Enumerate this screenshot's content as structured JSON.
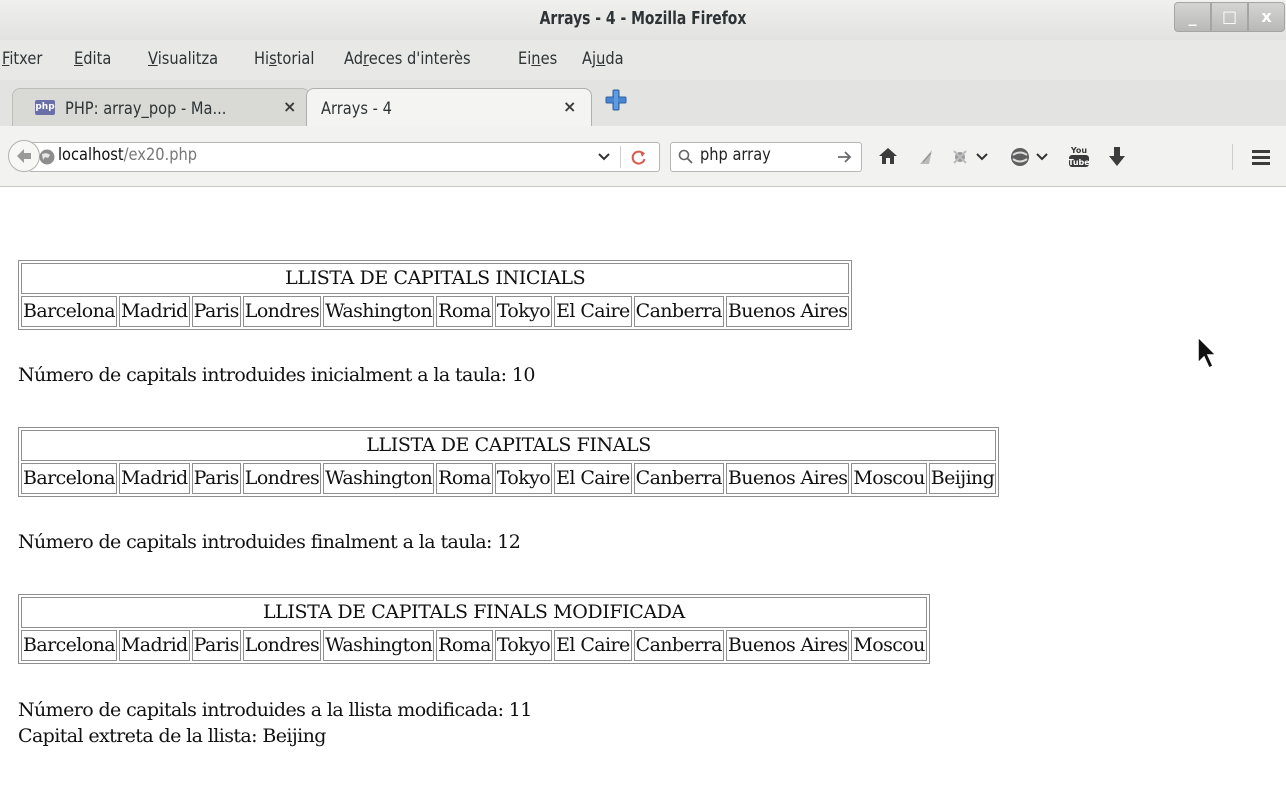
{
  "window": {
    "title": "Arrays - 4 - Mozilla Firefox",
    "minimize": "_",
    "maximize": "□",
    "close": "x"
  },
  "menu": [
    {
      "accel": "F",
      "rest": "itxer"
    },
    {
      "accel": "E",
      "rest": "dita"
    },
    {
      "accel": "V",
      "rest": "isualitza"
    },
    {
      "pre": "Hi",
      "accel": "s",
      "rest": "torial"
    },
    {
      "pre": "Ad",
      "accel": "r",
      "rest": "eces d'interès"
    },
    {
      "pre": "Ei",
      "accel": "n",
      "rest": "es"
    },
    {
      "pre": "Aj",
      "accel": "u",
      "rest": "da"
    }
  ],
  "tabs": [
    {
      "label": "PHP: array_pop - Ma...",
      "favicon": "php",
      "active": false
    },
    {
      "label": "Arrays - 4",
      "active": true
    }
  ],
  "tab_close_glyph": "×",
  "navbar": {
    "url_host": "localhost",
    "url_path": "/ex20.php",
    "search_value": "php array"
  },
  "icons": [
    "back-arrow-icon",
    "globe-icon",
    "dropdown-icon",
    "reload-icon",
    "search-icon",
    "search-go-icon",
    "home-icon",
    "bookmark-icon",
    "extension-icon",
    "pocket-icon",
    "youtube-icon",
    "download-icon",
    "menu-icon"
  ],
  "page": {
    "table1": {
      "heading": "LLISTA DE CAPITALS INICIALS",
      "cells": [
        "Barcelona",
        "Madrid",
        "Paris",
        "Londres",
        "Washington",
        "Roma",
        "Tokyo",
        "El Caire",
        "Canberra",
        "Buenos Aires"
      ]
    },
    "count1": "Número de capitals introduides inicialment a la taula: 10",
    "table2": {
      "heading": "LLISTA DE CAPITALS FINALS",
      "cells": [
        "Barcelona",
        "Madrid",
        "Paris",
        "Londres",
        "Washington",
        "Roma",
        "Tokyo",
        "El Caire",
        "Canberra",
        "Buenos Aires",
        "Moscou",
        "Beijing"
      ]
    },
    "count2": "Número de capitals introduides finalment a la taula: 12",
    "table3": {
      "heading": "LLISTA DE CAPITALS FINALS MODIFICADA",
      "cells": [
        "Barcelona",
        "Madrid",
        "Paris",
        "Londres",
        "Washington",
        "Roma",
        "Tokyo",
        "El Caire",
        "Canberra",
        "Buenos Aires",
        "Moscou"
      ]
    },
    "count3": "Número de capitals introduides a la llista modificada: 11",
    "extracted": "Capital extreta de la llista: Beijing"
  }
}
